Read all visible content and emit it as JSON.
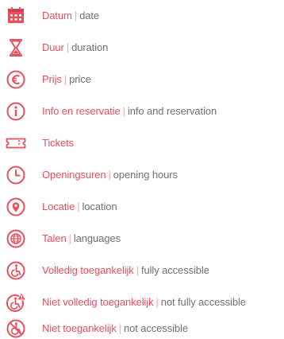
{
  "accent_color": "#e8505b",
  "separator": "|",
  "items": [
    {
      "icon": "calendar-icon",
      "label_nl": "Datum",
      "label_en": "date"
    },
    {
      "icon": "hourglass-icon",
      "label_nl": "Duur",
      "label_en": "duration"
    },
    {
      "icon": "euro-icon",
      "label_nl": "Prijs",
      "label_en": "price"
    },
    {
      "icon": "info-icon",
      "label_nl": "Info en reservatie",
      "label_en": "info and reservation"
    },
    {
      "icon": "ticket-icon",
      "label_nl": "Tickets",
      "label_en": ""
    },
    {
      "icon": "clock-icon",
      "label_nl": "Openingsuren",
      "label_en": "opening hours"
    },
    {
      "icon": "location-pin-icon",
      "label_nl": "Locatie",
      "label_en": "location"
    },
    {
      "icon": "globe-icon",
      "label_nl": "Talen",
      "label_en": "languages"
    },
    {
      "icon": "wheelchair-icon",
      "label_nl": "Volledig toegankelijk",
      "label_en": "fully accessible"
    },
    {
      "icon": "wheelchair-warning-icon",
      "label_nl": "Niet volledig toegankelijk",
      "label_en": "not fully accessible"
    },
    {
      "icon": "wheelchair-crossed-icon",
      "label_nl": "Niet toegankelijk",
      "label_en": "not accessible"
    }
  ]
}
